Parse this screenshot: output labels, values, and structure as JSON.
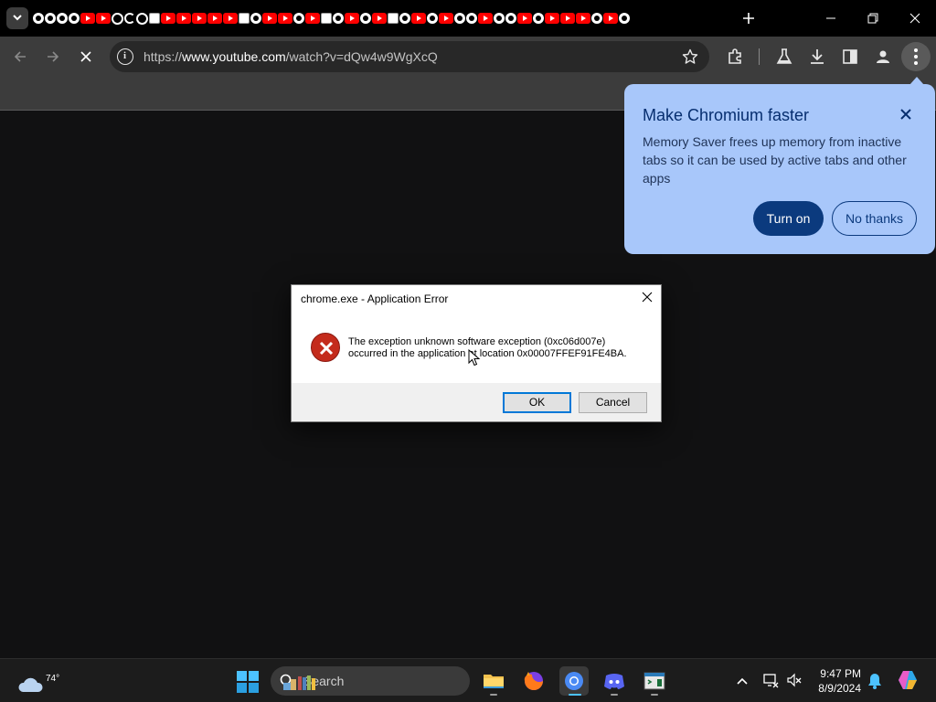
{
  "browser": {
    "url_host": "www.youtube.com",
    "url_path": "/watch?v=dQw4w9WgXcQ",
    "url_scheme": "https://",
    "tab_count": 44
  },
  "promo": {
    "title": "Make Chromium faster",
    "body": "Memory Saver frees up memory from inactive tabs so it can be used by active tabs and other apps",
    "turn_on_label": "Turn on",
    "no_thanks_label": "No thanks",
    "background_color": "#a8c7fa",
    "accent_color": "#0b3a7e"
  },
  "dialog": {
    "title": "chrome.exe - Application Error",
    "message_line1": "The exception unknown software exception (0xc06d007e)",
    "message_line2": "occurred in the application at location 0x00007FFEF91FE4BA.",
    "ok_label": "OK",
    "cancel_label": "Cancel",
    "icon": "error-x-icon"
  },
  "taskbar": {
    "temperature": "74°",
    "search_label": "Search",
    "time": "9:47 PM",
    "date": "8/9/2024",
    "apps": [
      "file-explorer",
      "firefox",
      "chromium",
      "discord",
      "terminal"
    ],
    "active_app": "chromium"
  }
}
